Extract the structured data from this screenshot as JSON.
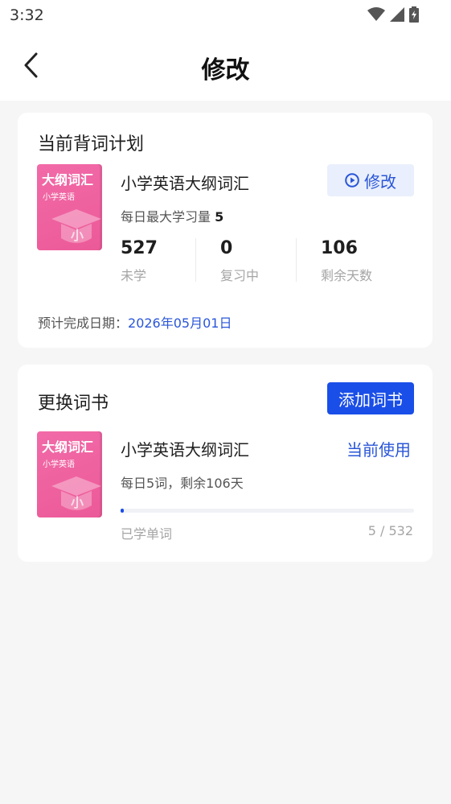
{
  "status_bar": {
    "time": "3:32"
  },
  "header": {
    "title": "修改"
  },
  "current_plan": {
    "section_title": "当前背词计划",
    "book": {
      "cover_title": "大纲词汇",
      "cover_subtitle": "小学英语",
      "name": "小学英语大纲词汇"
    },
    "daily_label": "每日最大学习量",
    "daily_value": "5",
    "modify_label": "修改",
    "stats": [
      {
        "value": "527",
        "label": "未学"
      },
      {
        "value": "0",
        "label": "复习中"
      },
      {
        "value": "106",
        "label": "剩余天数"
      }
    ],
    "eta_label": "预计完成日期：",
    "eta_date": "2026年05月01日"
  },
  "change_book": {
    "section_title": "更换词书",
    "add_label": "添加词书",
    "book": {
      "cover_title": "大纲词汇",
      "cover_subtitle": "小学英语",
      "name": "小学英语大纲词汇"
    },
    "current_label": "当前使用",
    "summary": "每日5词，剩余106天",
    "progress": {
      "learned": 5,
      "total": 532
    },
    "learned_label": "已学单词",
    "learned_text": "5 / 532"
  },
  "colors": {
    "accent": "#1a4ee8",
    "link": "#2a56d8",
    "book_cover": "#ec5a98"
  }
}
